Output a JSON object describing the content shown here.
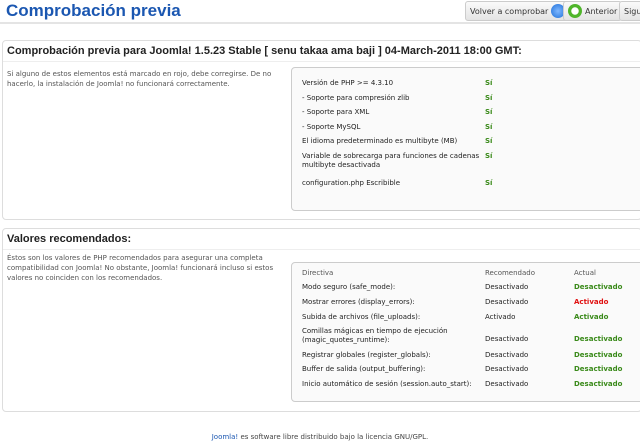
{
  "header": {
    "title": "Comprobación previa",
    "recheck": "Volver a comprobar",
    "previous": "Anterior",
    "next": "Sigu"
  },
  "precheck": {
    "title": "Comprobación previa para Joomla! 1.5.23 Stable [ senu takaa ama baji ] 04-March-2011 18:00 GMT:",
    "intro": "Si alguno de estos elementos está marcado en rojo, debe corregirse. De no hacerlo, la instalación de Joomla! no funcionará correctamente.",
    "items": [
      {
        "label": "Versión de PHP >= 4.3.10",
        "value": "Sí"
      },
      {
        "label": "- Soporte para compresión zlib",
        "value": "Sí"
      },
      {
        "label": "- Soporte para XML",
        "value": "Sí"
      },
      {
        "label": "- Soporte MySQL",
        "value": "Sí"
      },
      {
        "label": "El idioma predeterminado es multibyte (MB)",
        "value": "Sí"
      },
      {
        "label": "Variable de sobrecarga para funciones de cadenas multibyte desactivada",
        "value": "Sí"
      },
      {
        "label": "configuration.php Escribible",
        "value": "Sí"
      }
    ]
  },
  "recommended": {
    "title": "Valores recomendados:",
    "intro": "Éstos son los valores de PHP recomendados para asegurar una completa compatibilidad con Joomla! No obstante, Joomla! funcionará incluso si estos valores no coinciden con los recomendados.",
    "headers": [
      "Directiva",
      "Recomendado",
      "Actual"
    ],
    "rows": [
      {
        "directive": "Modo seguro (safe_mode):",
        "recommended": "Desactivado",
        "actual": "Desactivado",
        "status": "ok"
      },
      {
        "directive": "Mostrar errores (display_errors):",
        "recommended": "Desactivado",
        "actual": "Activado",
        "status": "bad"
      },
      {
        "directive": "Subida de archivos (file_uploads):",
        "recommended": "Activado",
        "actual": "Activado",
        "status": "ok"
      },
      {
        "directive": "Comillas mágicas en tiempo de ejecución (magic_quotes_runtime):",
        "recommended": "Desactivado",
        "actual": "Desactivado",
        "status": "ok"
      },
      {
        "directive": "Registrar globales (register_globals):",
        "recommended": "Desactivado",
        "actual": "Desactivado",
        "status": "ok"
      },
      {
        "directive": "Buffer de salida (output_buffering):",
        "recommended": "Desactivado",
        "actual": "Desactivado",
        "status": "ok"
      },
      {
        "directive": "Inicio automático de sesión (session.auto_start):",
        "recommended": "Desactivado",
        "actual": "Desactivado",
        "status": "ok"
      }
    ]
  },
  "footer": {
    "link": "Joomla!",
    "text": " es software libre distribuido bajo la licencia GNU/GPL."
  }
}
